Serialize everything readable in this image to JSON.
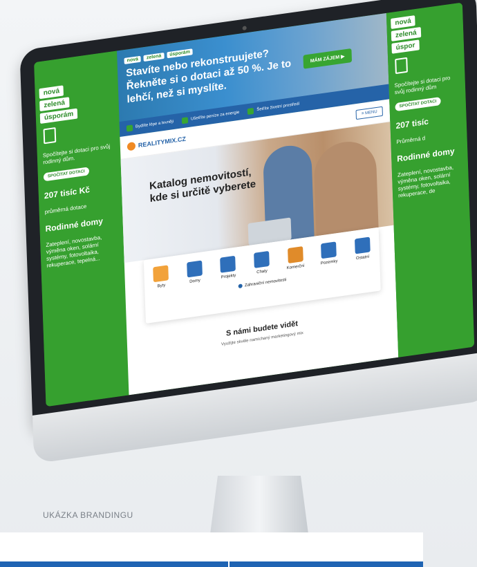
{
  "caption": "UKÁZKA BRANDINGU",
  "left_panel": {
    "tags": [
      "nová",
      "zelená",
      "úsporám"
    ],
    "calc_text": "Spočítejte si dotaci pro svůj rodinný dům.",
    "calc_button": "SPOČÍTAT DOTACI",
    "amount": "207 tisíc Kč",
    "amount_sub": "průměrná dotace",
    "houses_title": "Rodinné domy",
    "houses_text": "Zateplení, novostavba, výměna oken, solární systémy, fotovoltaika, rekuperace, tepelná..."
  },
  "right_panel": {
    "tags": [
      "nová",
      "zelená",
      "úspor"
    ],
    "calc_text": "Spočítejte si dotaci pro svůj rodinný dům",
    "calc_button": "SPOČÍTAT DOTACI",
    "amount": "207 tisíc",
    "amount_sub": "Průměrná d",
    "houses_title": "Rodinné domy",
    "houses_text": "Zateplení, novostavba, výměna oken, solární systémy, fotovoltaika, rekuperace, de"
  },
  "banner": {
    "chips": [
      "nová",
      "zelená",
      "úsporám"
    ],
    "headline": "Stavíte nebo rekonstruujete? Řekněte si o dotaci až 50 %. Je to lehčí, než si myslíte.",
    "cta": "MÁM ZÁJEM ▶",
    "items": [
      "Bydlíte lépe a levněji",
      "Ušetříte peníze za energie",
      "Šetříte životní prostředí"
    ]
  },
  "site": {
    "logo": "REALITYMIX.CZ",
    "menu": "≡ MENU",
    "hero_title": "Katalog nemovitostí, kde si určitě vyberete",
    "categories": [
      "Byty",
      "Domy",
      "Projekty",
      "Chaty",
      "Komerční",
      "Pozemky",
      "Ostatní"
    ],
    "category_colors": [
      "#f2a23a",
      "#2f6fba",
      "#2f6fba",
      "#2f6fba",
      "#e08b2a",
      "#2f6fba",
      "#2f6fba"
    ],
    "foreign": "Zahraniční nemovitosti",
    "section_title": "S námi budete vidět",
    "section_sub": "Využijte skvěle namíchaný marketingový mix"
  }
}
